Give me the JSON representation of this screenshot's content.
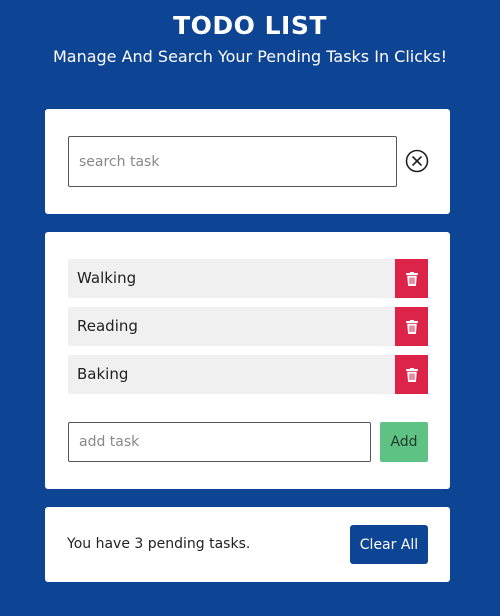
{
  "header": {
    "title": "TODO LIST",
    "subtitle": "Manage And Search Your Pending Tasks In Clicks!"
  },
  "search": {
    "placeholder": "search task",
    "value": "",
    "clear_icon": "circle-x-icon"
  },
  "tasks": {
    "items": [
      {
        "label": "Walking",
        "delete_icon": "trash-icon"
      },
      {
        "label": "Reading",
        "delete_icon": "trash-icon"
      },
      {
        "label": "Baking",
        "delete_icon": "trash-icon"
      }
    ],
    "add_placeholder": "add task",
    "add_value": "",
    "add_label": "Add"
  },
  "footer": {
    "pending_text": "You have 3 pending tasks.",
    "clear_all_label": "Clear All"
  },
  "colors": {
    "background": "#0e4494",
    "delete": "#dc2348",
    "add": "#5fc285",
    "clear_all": "#0e4494"
  }
}
